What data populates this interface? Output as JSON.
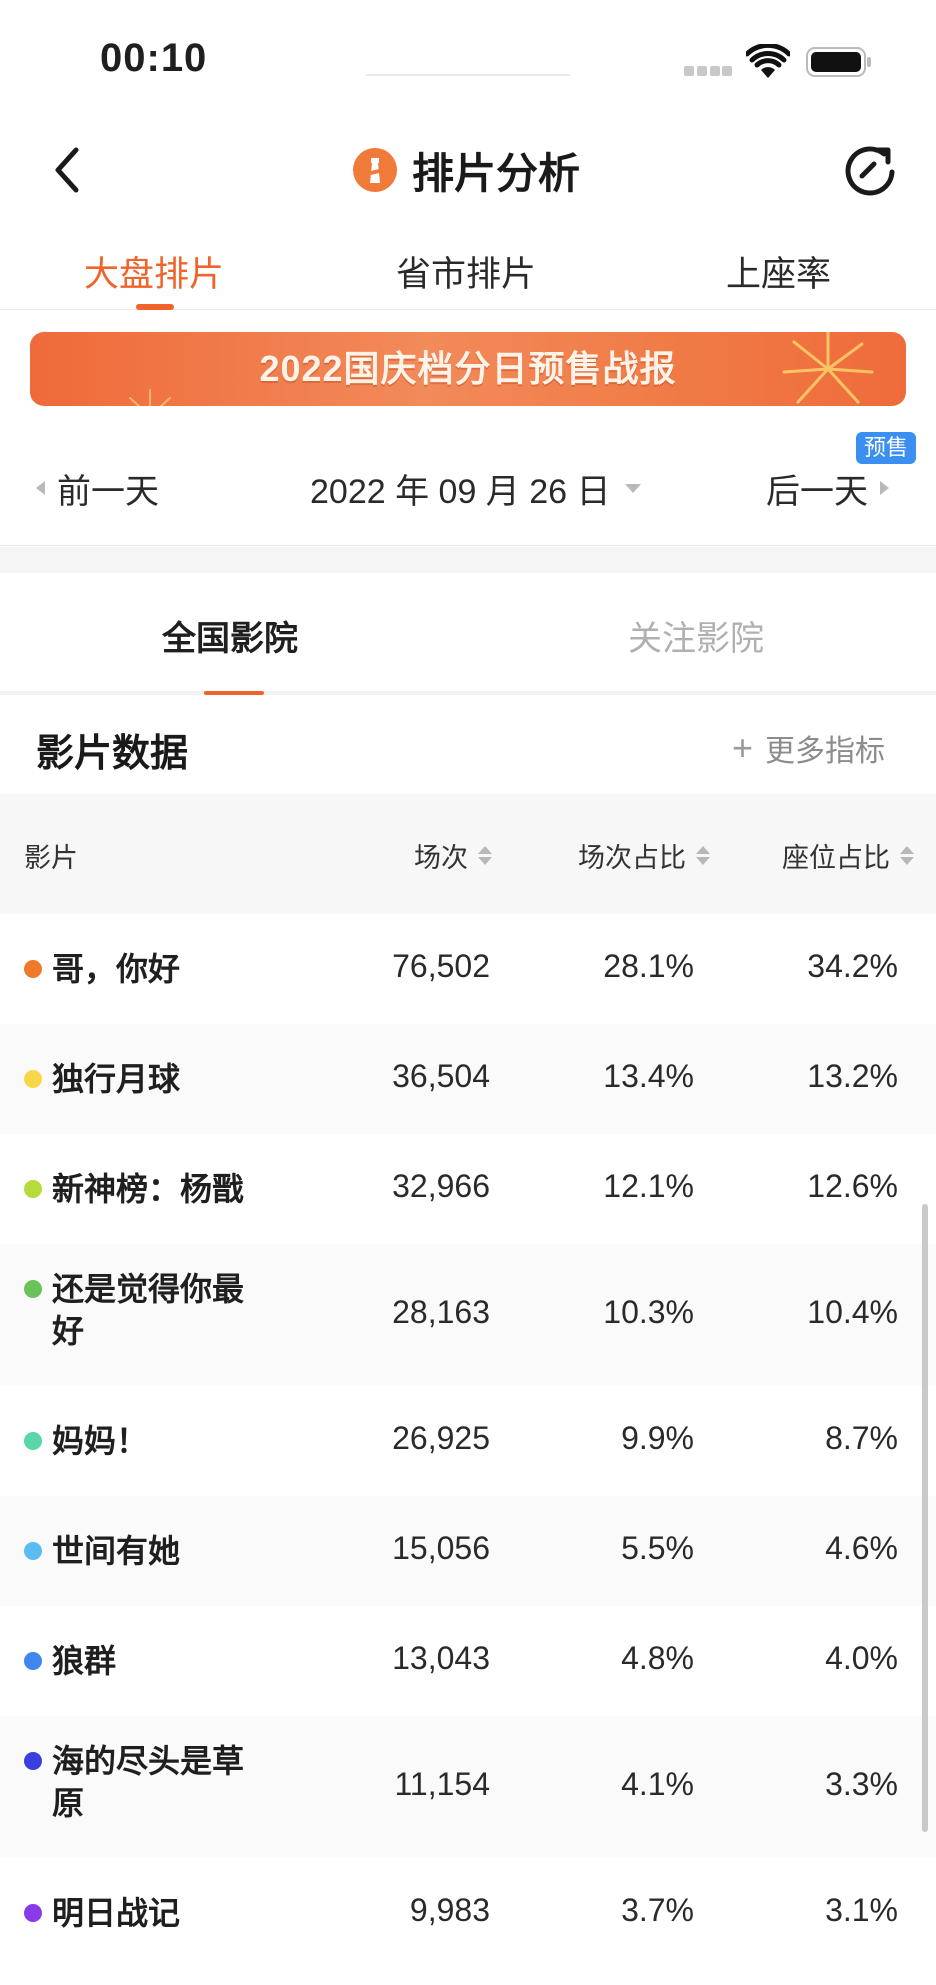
{
  "status_bar": {
    "time": "00:10"
  },
  "nav": {
    "title": "排片分析"
  },
  "main_tabs": [
    {
      "label": "大盘排片",
      "active": true
    },
    {
      "label": "省市排片",
      "active": false
    },
    {
      "label": "上座率",
      "active": false
    }
  ],
  "banner": {
    "text": "2022国庆档分日预售战报"
  },
  "date_nav": {
    "prev_label": "前一天",
    "date": "2022 年 09 月 26 日",
    "next_label": "后一天",
    "badge": "预售"
  },
  "cinema_tabs": [
    {
      "label": "全国影院",
      "active": true
    },
    {
      "label": "关注影院",
      "active": false
    }
  ],
  "section": {
    "title": "影片数据",
    "more_label": "更多指标"
  },
  "table": {
    "headers": {
      "film": "影片",
      "sessions": "场次",
      "session_ratio": "场次占比",
      "seat_ratio": "座位占比"
    },
    "rows": [
      {
        "name": "哥，你好",
        "sessions": "76,502",
        "session_ratio": "28.1%",
        "seat_ratio": "34.2%",
        "color": "#f07a2c"
      },
      {
        "name": "独行月球",
        "sessions": "36,504",
        "session_ratio": "13.4%",
        "seat_ratio": "13.2%",
        "color": "#f7d64a"
      },
      {
        "name": "新神榜：杨戬",
        "sessions": "32,966",
        "session_ratio": "12.1%",
        "seat_ratio": "12.6%",
        "color": "#b5dc3a"
      },
      {
        "name": "还是觉得你最好",
        "sessions": "28,163",
        "session_ratio": "10.3%",
        "seat_ratio": "10.4%",
        "color": "#6cc25a"
      },
      {
        "name": "妈妈！",
        "sessions": "26,925",
        "session_ratio": "9.9%",
        "seat_ratio": "8.7%",
        "color": "#5ad6a8"
      },
      {
        "name": "世间有她",
        "sessions": "15,056",
        "session_ratio": "5.5%",
        "seat_ratio": "4.6%",
        "color": "#5bbcf2"
      },
      {
        "name": "狼群",
        "sessions": "13,043",
        "session_ratio": "4.8%",
        "seat_ratio": "4.0%",
        "color": "#3f86ee"
      },
      {
        "name": "海的尽头是草原",
        "sessions": "11,154",
        "session_ratio": "4.1%",
        "seat_ratio": "3.3%",
        "color": "#3b3fe0"
      },
      {
        "name": "明日战记",
        "sessions": "9,983",
        "session_ratio": "3.7%",
        "seat_ratio": "3.1%",
        "color": "#8a3be8"
      }
    ]
  }
}
